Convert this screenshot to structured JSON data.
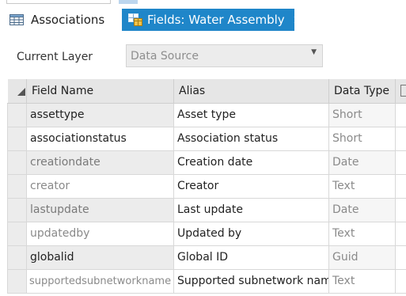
{
  "tabs": [
    {
      "label": "Associations",
      "icon": "table-icon",
      "active": false
    },
    {
      "label": "Fields:  Water Assembly",
      "icon": "fields-table-icon",
      "active": true
    }
  ],
  "current_layer": {
    "label": "Current Layer",
    "selected_value": "Data Source"
  },
  "grid": {
    "columns": [
      "Field Name",
      "Alias",
      "Data Type"
    ],
    "rows": [
      {
        "field_name": "assettype",
        "alias": "Asset type",
        "data_type": "Short"
      },
      {
        "field_name": "associationstatus",
        "alias": "Association status",
        "data_type": "Short"
      },
      {
        "field_name": "creationdate",
        "alias": "Creation date",
        "data_type": "Date"
      },
      {
        "field_name": "creator",
        "alias": "Creator",
        "data_type": "Text"
      },
      {
        "field_name": "lastupdate",
        "alias": "Last update",
        "data_type": "Date"
      },
      {
        "field_name": "updatedby",
        "alias": "Updated by",
        "data_type": "Text"
      },
      {
        "field_name": "globalid",
        "alias": "Global ID",
        "data_type": "Guid"
      },
      {
        "field_name": "supportedsubnetworkname",
        "alias": "Supported subnetwork name",
        "data_type": "Text"
      }
    ]
  },
  "colors": {
    "accent": "#1f86c9",
    "header_bg": "#e6e6e6",
    "disabled_text": "#8a8a8a"
  }
}
